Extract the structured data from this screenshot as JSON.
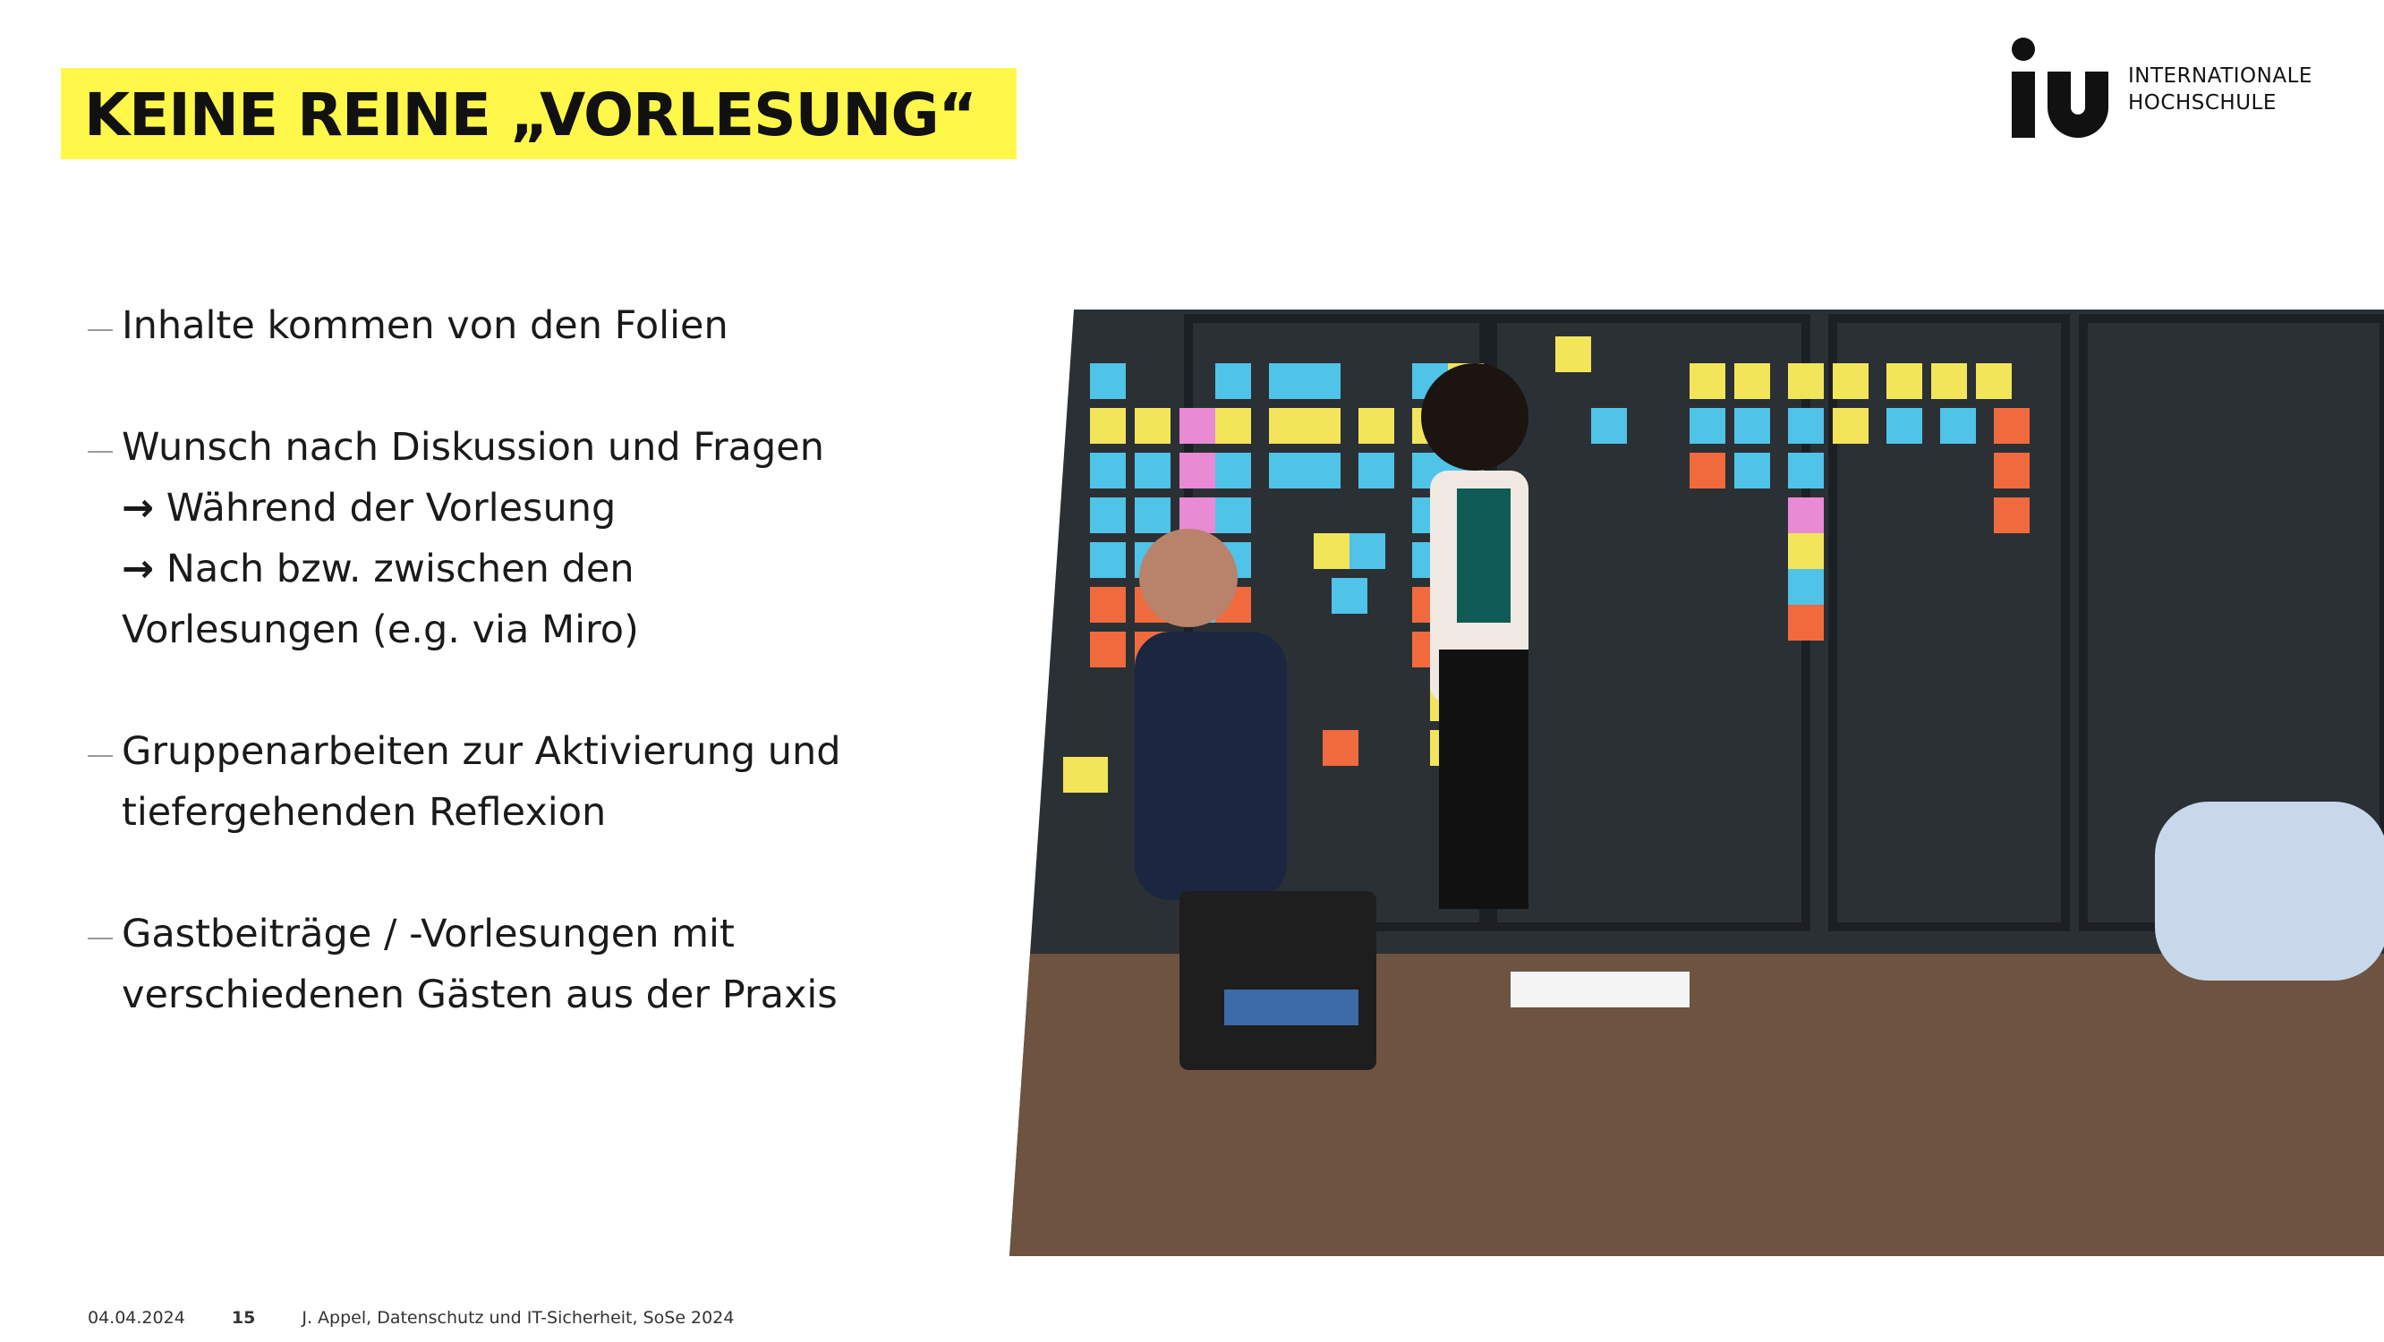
{
  "slide": {
    "title": "KEINE REINE „VORLESUNG“"
  },
  "logo": {
    "line1": "INTERNATIONALE",
    "line2": "HOCHSCHULE"
  },
  "bullets": [
    {
      "lines": [
        "Inhalte kommen von den Folien"
      ]
    },
    {
      "lines": [
        "Wunsch nach Diskussion und Fragen"
      ],
      "subs": [
        {
          "arrow": "→",
          "text": " Während der Vorlesung"
        },
        {
          "arrow": "→",
          "text": " Nach bzw. zwischen den"
        }
      ],
      "continuation": "Vorlesungen (e.g. via Miro)"
    },
    {
      "lines": [
        "Gruppenarbeiten zur Aktivierung und",
        "tiefergehenden Reflexion"
      ]
    },
    {
      "lines": [
        "Gastbeiträge / -Vorlesungen mit",
        "verschiedenen Gästen aus der Praxis"
      ]
    }
  ],
  "footer": {
    "date": "04.04.2024",
    "page": "15",
    "text": "J. Appel, Datenschutz und IT-Sicherheit, SoSe 2024"
  },
  "colors": {
    "accent_yellow": "#fff84a",
    "board_dark": "#2b3035"
  }
}
